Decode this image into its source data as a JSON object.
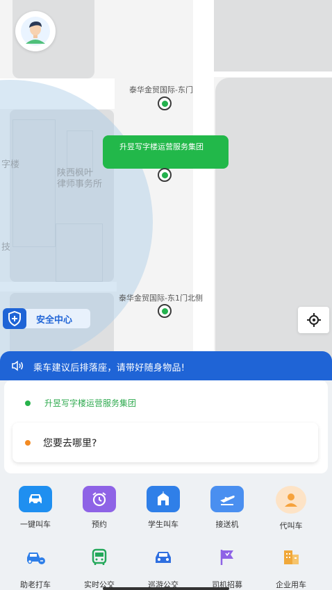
{
  "map": {
    "pois": [
      {
        "name": "泰华金贸国际-东门"
      },
      {
        "name": "泰华金贸国际-东1门北侧"
      }
    ],
    "faint_labels": [
      "陕西枫叶",
      "律师事务所",
      "字楼",
      "技"
    ],
    "selected_pickup": "升昱写字楼运营服务集团",
    "safety_center": "安全中心"
  },
  "notice": {
    "text": "乘车建议后排落座，请带好随身物品!"
  },
  "trip": {
    "origin": "升昱写字楼运营服务集团",
    "destination_placeholder": "您要去哪里?"
  },
  "services_row1": [
    {
      "label": "一键叫车",
      "icon": "car-icon",
      "color": "#1f8ff0"
    },
    {
      "label": "预约",
      "icon": "alarm-clock-icon",
      "color": "#8e63e6"
    },
    {
      "label": "学生叫车",
      "icon": "school-icon",
      "color": "#2f7fe8"
    },
    {
      "label": "接送机",
      "icon": "airplane-icon",
      "color": "#4a8ff0"
    },
    {
      "label": "代叫车",
      "icon": "person-icon",
      "color": "#f6a23c"
    }
  ],
  "services_row2": [
    {
      "label": "助老打车",
      "icon": "elderly-car-icon",
      "color": "#2f7fe8"
    },
    {
      "label": "实时公交",
      "icon": "bus-icon",
      "color": "#23a85a"
    },
    {
      "label": "巡游公交",
      "icon": "cruise-car-icon",
      "color": "#2f6fe0"
    },
    {
      "label": "司机招募",
      "icon": "flag-icon",
      "color": "#8e63e6"
    },
    {
      "label": "企业用车",
      "icon": "building-icon",
      "color": "#f0a83a"
    }
  ],
  "colors": {
    "primary": "#1f64d6",
    "green": "#22b84a",
    "orange": "#f38a22"
  }
}
